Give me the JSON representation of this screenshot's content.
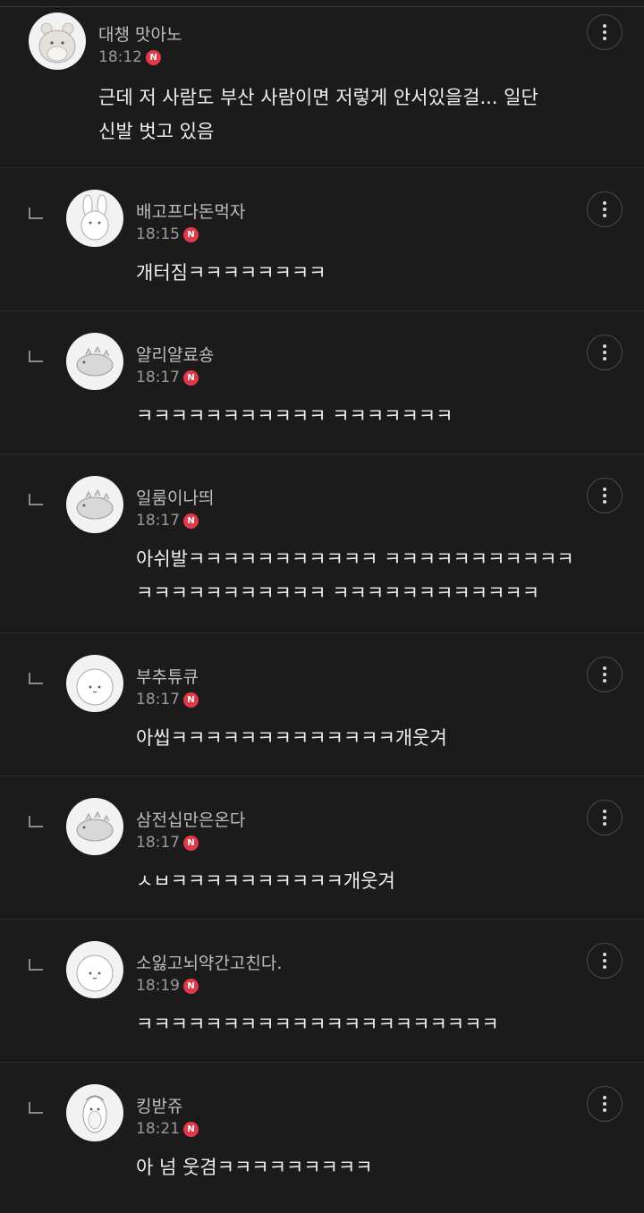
{
  "comments": [
    {
      "nickname": "대챙 맛아노",
      "time": "18:12",
      "badge": "N",
      "avatar": "hamster-avatar",
      "text": "근데 저 사람도 부산 사람이면 저렇게 안서있을걸... 일단\n신발 벗고 있음"
    },
    {
      "nickname": "배고프다돈먹자",
      "time": "18:15",
      "badge": "N",
      "avatar": "rabbit-avatar",
      "text": "개터짐ㅋㅋㅋㅋㅋㅋㅋㅋ"
    },
    {
      "nickname": "얄리얄료숑",
      "time": "18:17",
      "badge": "N",
      "avatar": "dino-avatar",
      "text": "ㅋㅋㅋㅋㅋㅋㅋㅋㅋㅋㅋ ㅋㅋㅋㅋㅋㅋㅋ"
    },
    {
      "nickname": "일룸이나띄",
      "time": "18:17",
      "badge": "N",
      "avatar": "dino-avatar",
      "text": "아쉬발ㅋㅋㅋㅋㅋㅋㅋㅋㅋㅋㅋ ㅋㅋㅋㅋㅋㅋㅋㅋㅋㅋㅋ\nㅋㅋㅋㅋㅋㅋㅋㅋㅋㅋㅋ ㅋㅋㅋㅋㅋㅋㅋㅋㅋㅋㅋㅋ"
    },
    {
      "nickname": "부추튜큐",
      "time": "18:17",
      "badge": "N",
      "avatar": "blob-avatar",
      "text": "아씹ㅋㅋㅋㅋㅋㅋㅋㅋㅋㅋㅋㅋㅋ개웃겨"
    },
    {
      "nickname": "삼전십만은온다",
      "time": "18:17",
      "badge": "N",
      "avatar": "dino-avatar",
      "text": "ㅅㅂㅋㅋㅋㅋㅋㅋㅋㅋㅋㅋ개웃겨"
    },
    {
      "nickname": "소잃고뇌약간고친다.",
      "time": "18:19",
      "badge": "N",
      "avatar": "blob-avatar",
      "text": "ㅋㅋㅋㅋㅋㅋㅋㅋㅋㅋㅋㅋㅋㅋㅋㅋㅋㅋㅋㅋㅋ"
    },
    {
      "nickname": "킹받쥬",
      "time": "18:21",
      "badge": "N",
      "avatar": "penguin-avatar",
      "text": "아 넘 웃겸ㅋㅋㅋㅋㅋㅋㅋㅋㅋ"
    }
  ]
}
